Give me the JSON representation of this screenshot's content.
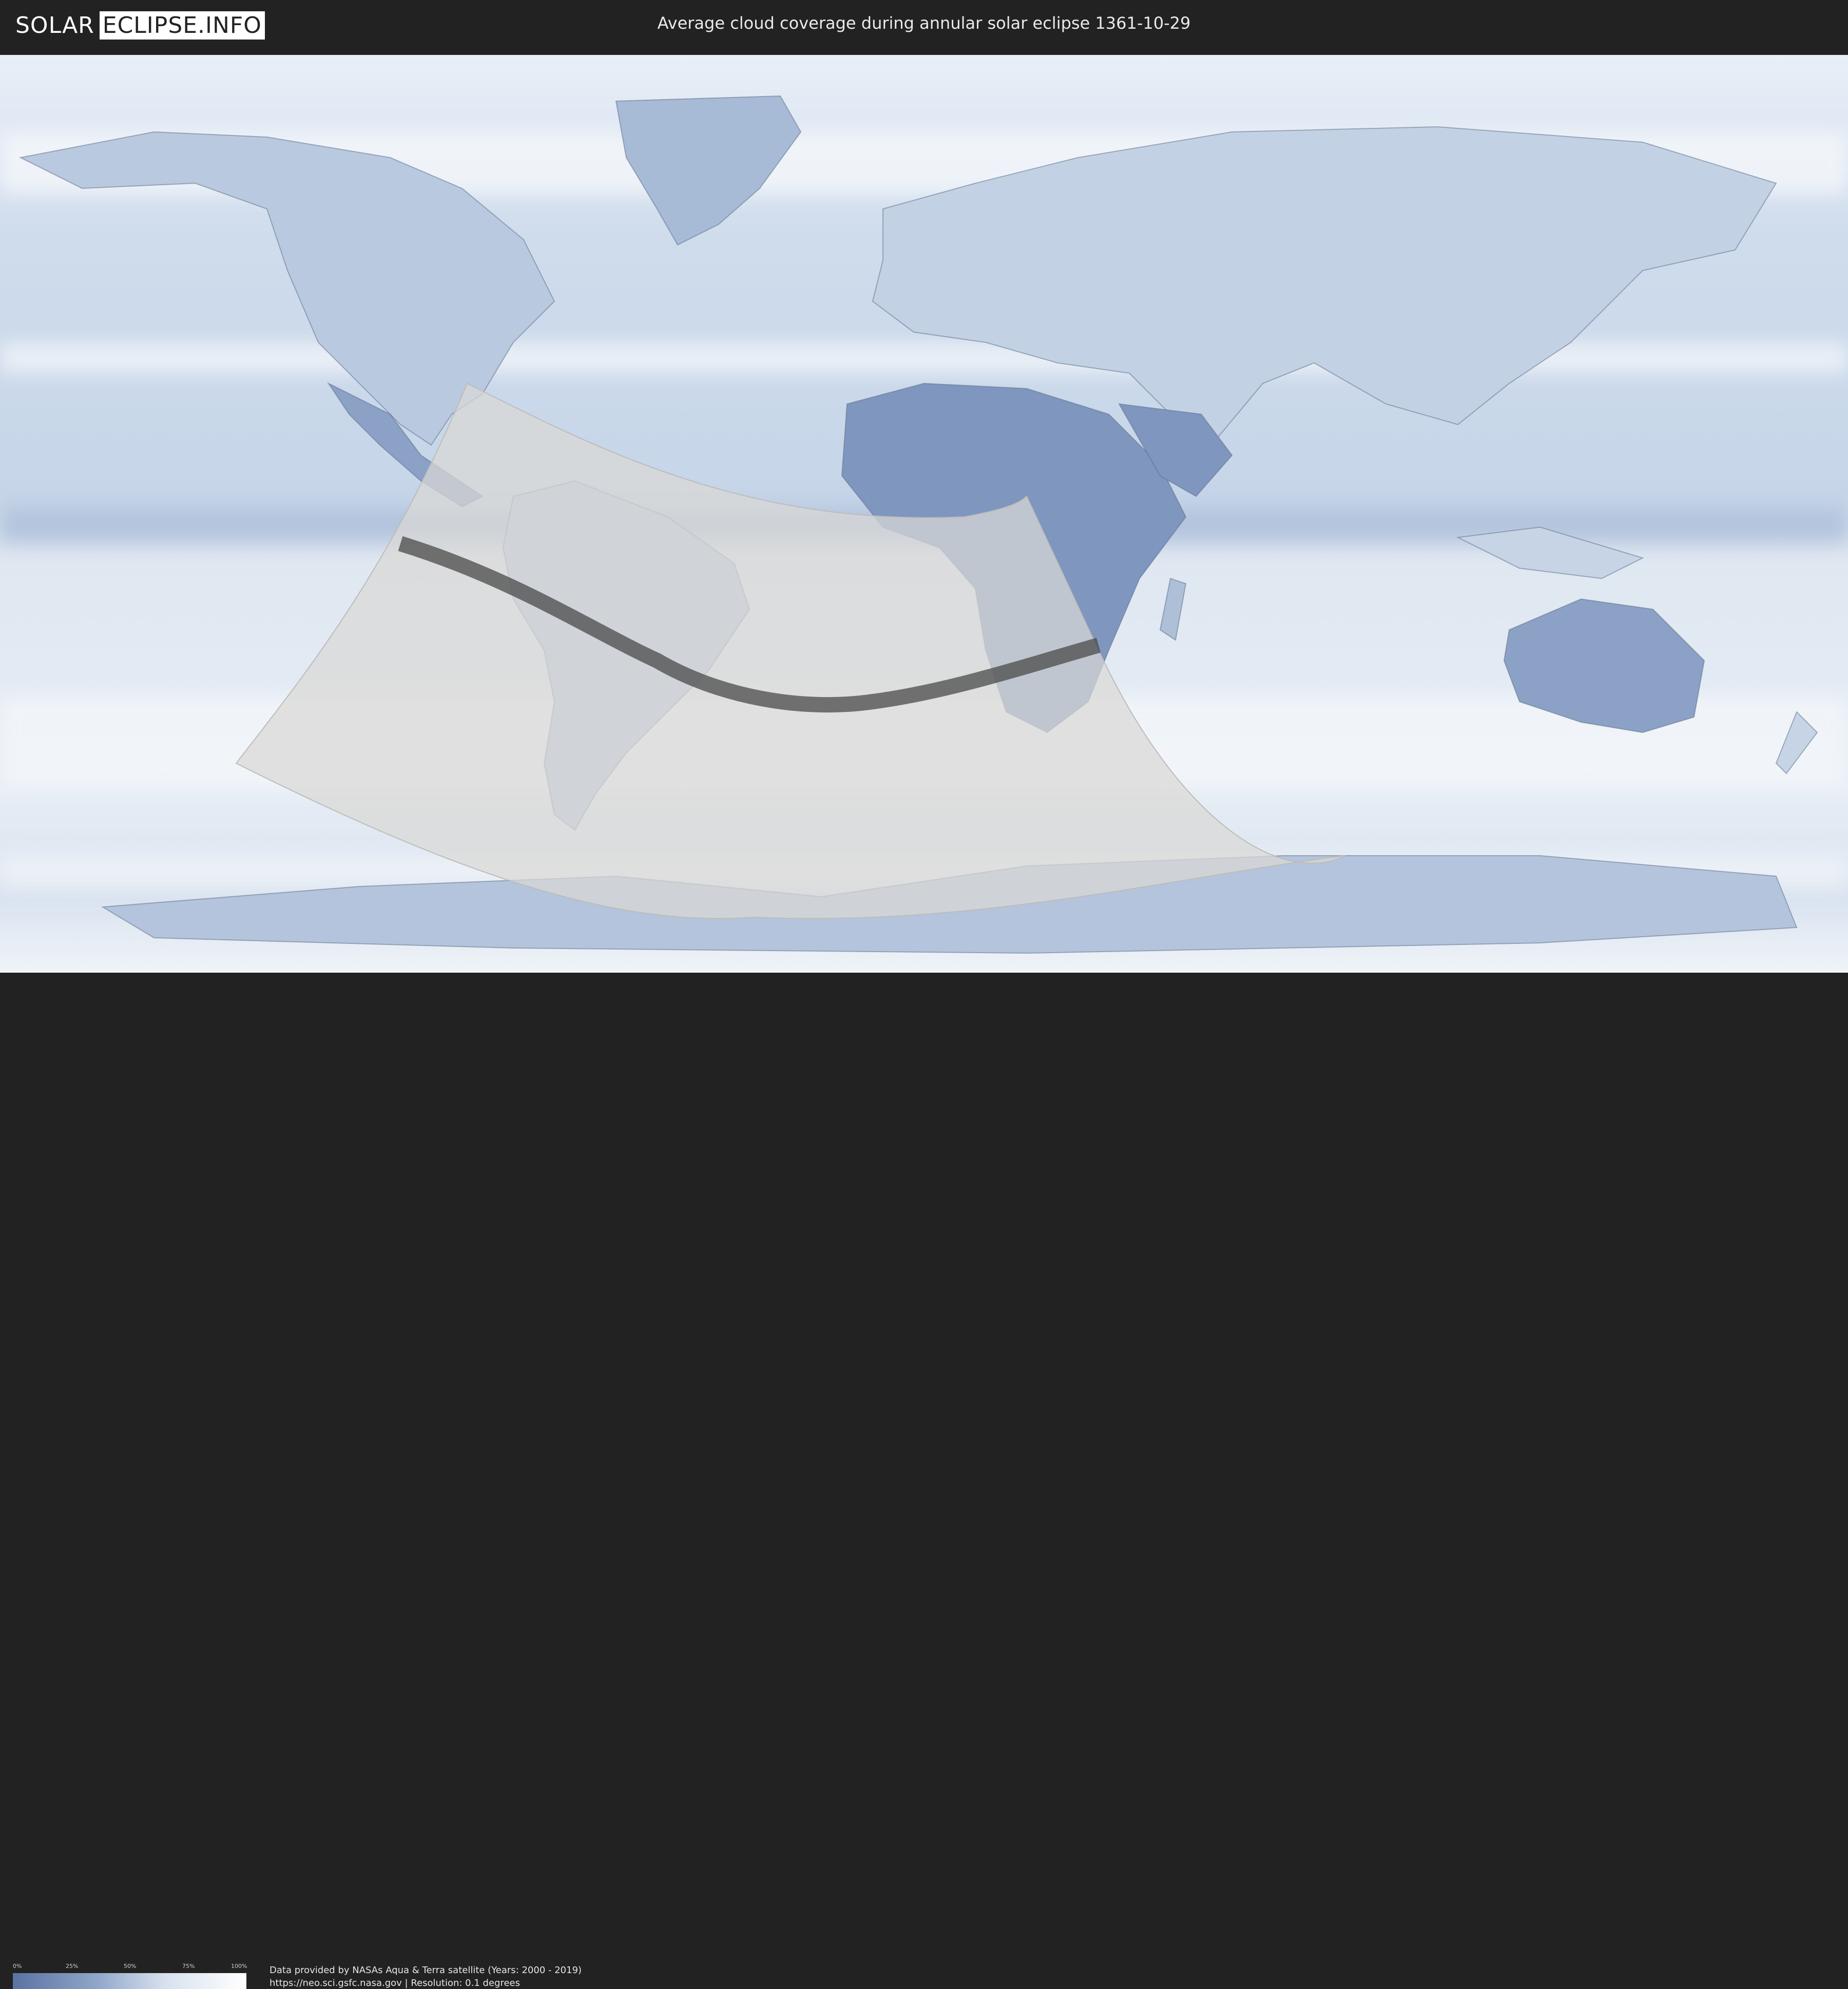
{
  "header": {
    "logo": {
      "part_a": "SOLAR",
      "part_b": "ECLIPSE.INFO"
    },
    "title": "Average cloud coverage during annular solar eclipse 1361-10-29"
  },
  "legend": {
    "ticks": [
      "0%",
      "25%",
      "50%",
      "75%",
      "100%"
    ],
    "colors": {
      "low": "#5a73a2",
      "high": "#ffffff"
    }
  },
  "footer": {
    "credit_line1": "Data provided by NASAs Aqua & Terra satellite (Years: 2000 - 2019)",
    "credit_line2": "https://neo.sci.gsfc.nasa.gov | Resolution: 0.1 degrees"
  },
  "colors": {
    "background": "#222222",
    "ocean_cloud": "#dfe8f3",
    "land_clear": "#7a92bd",
    "eclipse_zone": "#d9d8d6",
    "annular_path": "#4a4a4a"
  }
}
